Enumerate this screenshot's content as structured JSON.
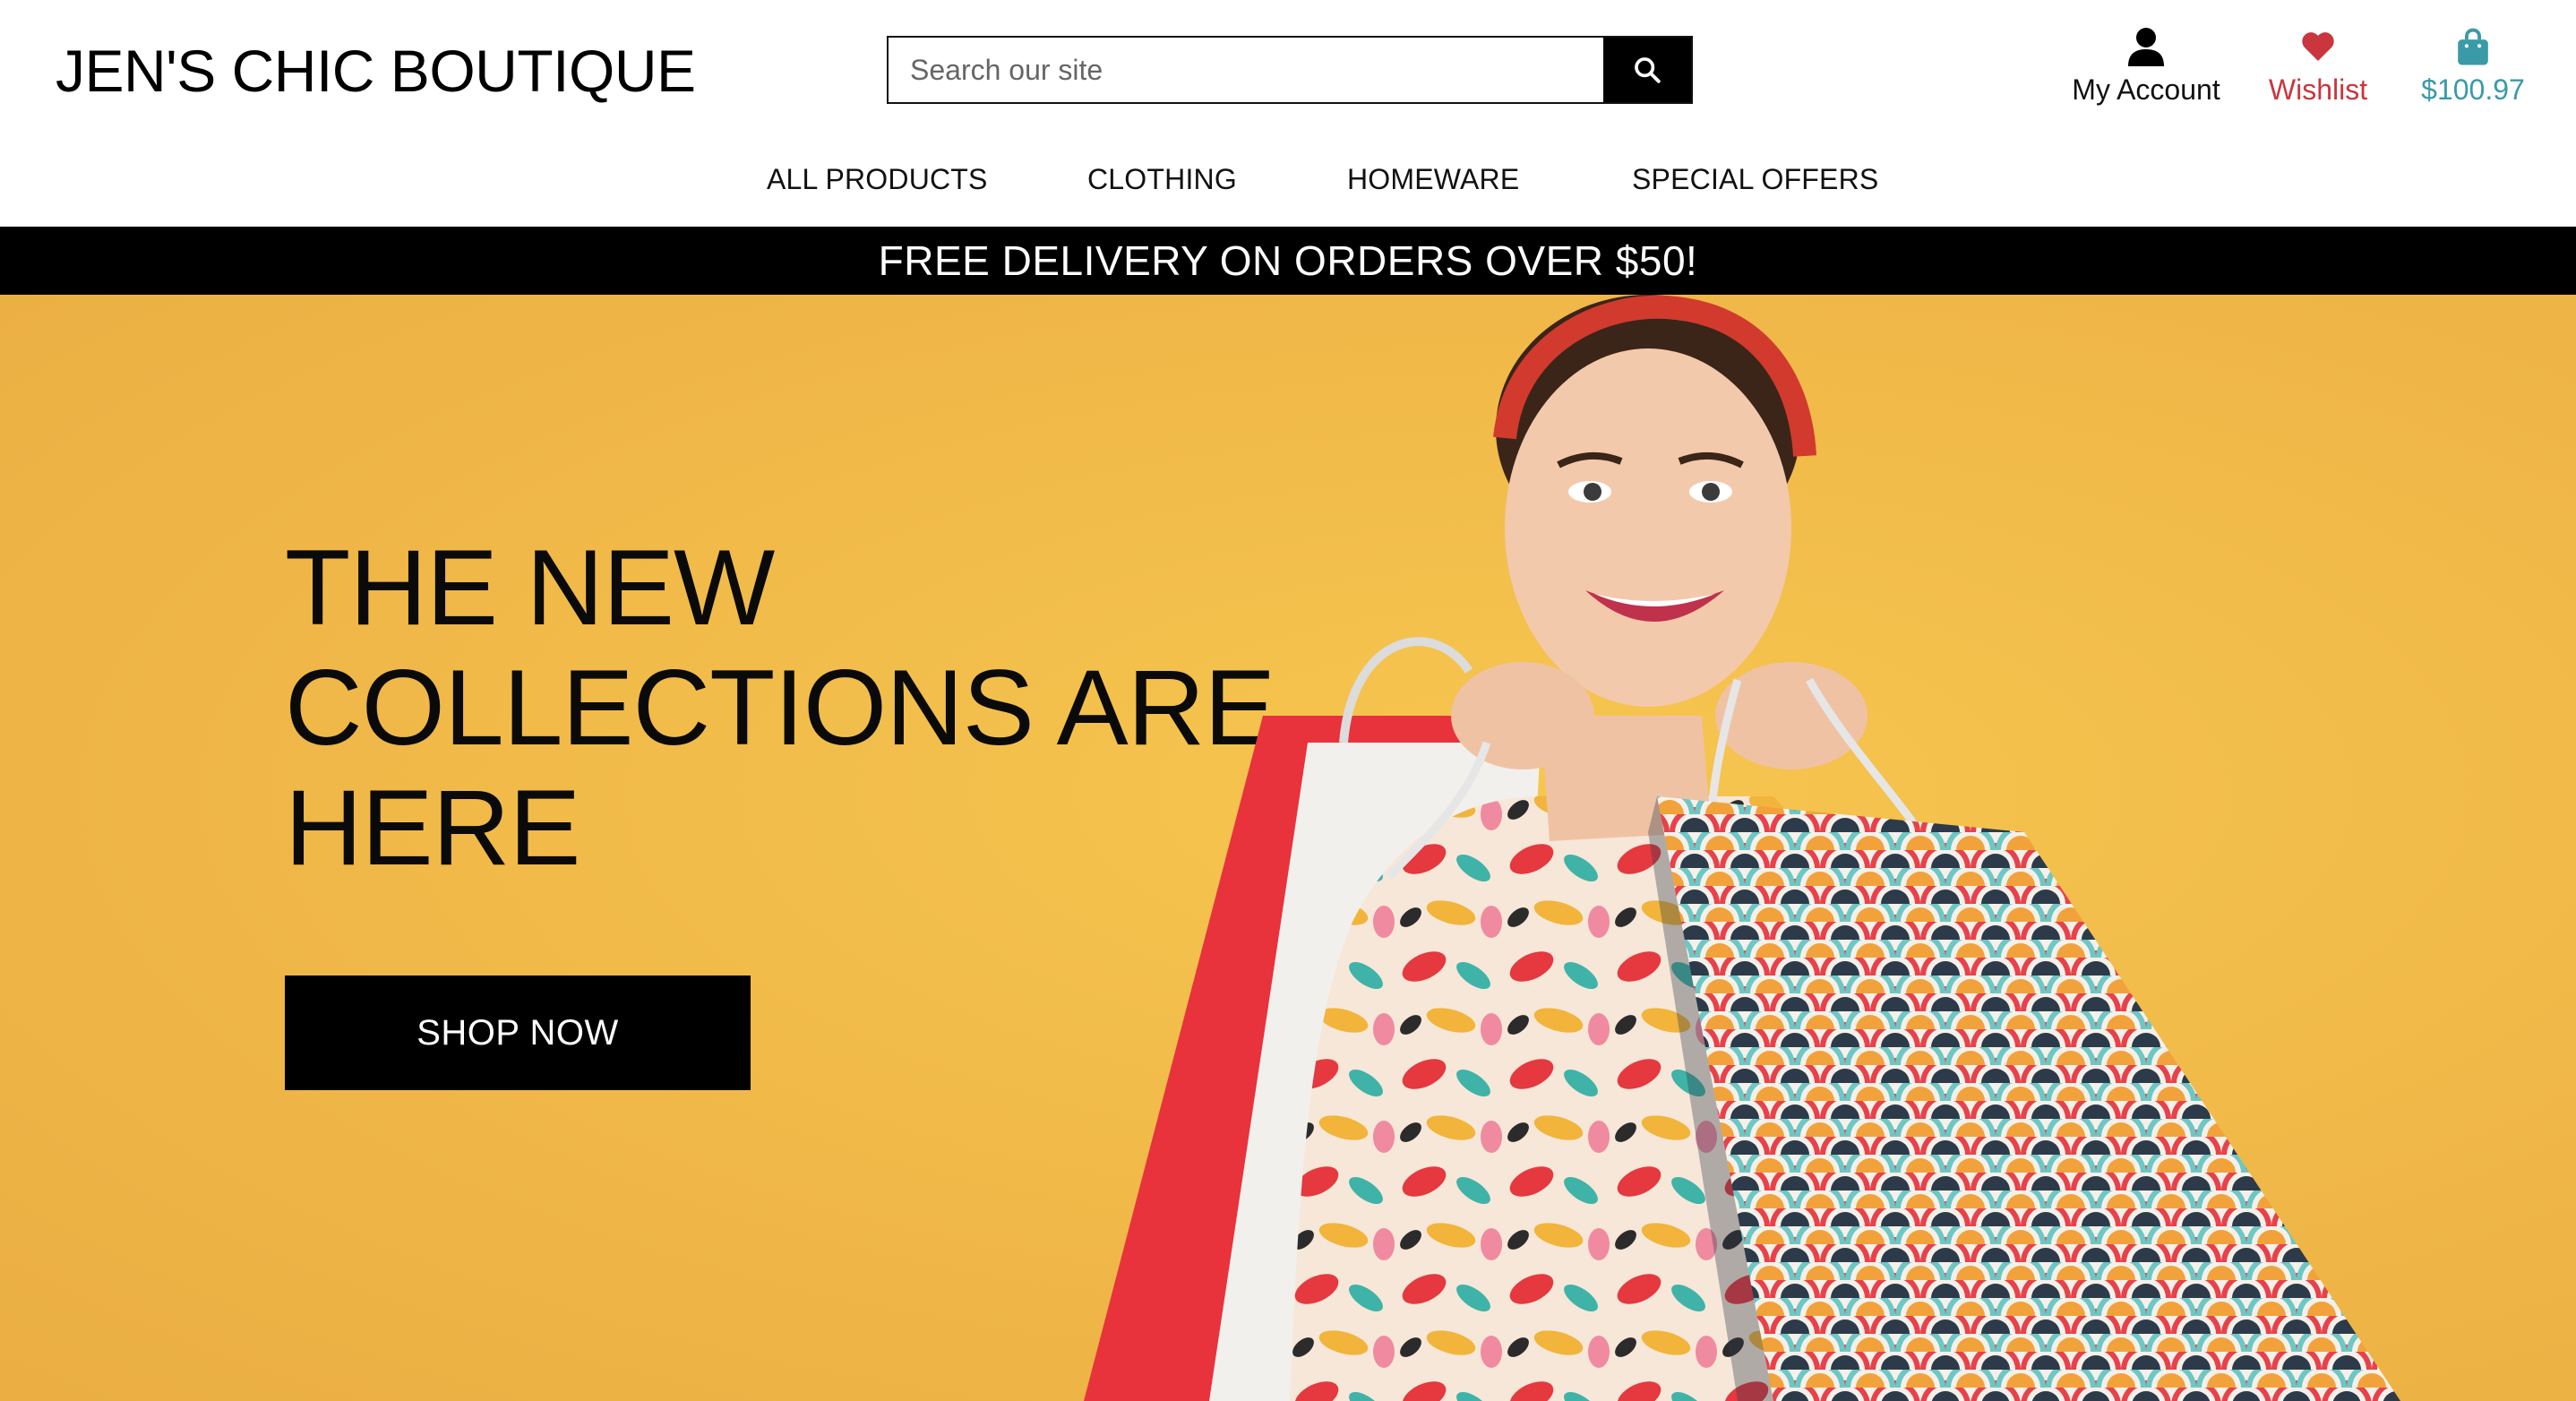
{
  "header": {
    "brand": "JEN'S CHIC BOUTIQUE",
    "search": {
      "placeholder": "Search our site",
      "value": "",
      "button_icon": "search-icon"
    },
    "account": {
      "label": "My Account",
      "icon": "user-icon"
    },
    "wishlist": {
      "label": "Wishlist",
      "icon": "heart-icon",
      "color": "#c9363e"
    },
    "cart": {
      "label": "$100.97",
      "icon": "shopping-bag-icon",
      "color": "#3a9aa8"
    }
  },
  "nav": {
    "items": [
      {
        "label": "ALL PRODUCTS"
      },
      {
        "label": "CLOTHING"
      },
      {
        "label": "HOMEWARE"
      },
      {
        "label": "SPECIAL OFFERS"
      }
    ]
  },
  "promo": {
    "text": "FREE DELIVERY ON ORDERS OVER $50!"
  },
  "hero": {
    "title_lines": [
      "THE NEW",
      "COLLECTIONS ARE",
      "HERE"
    ],
    "cta_label": "SHOP NOW",
    "background_color": "#f0b848",
    "image": "woman-with-shopping-bags"
  }
}
